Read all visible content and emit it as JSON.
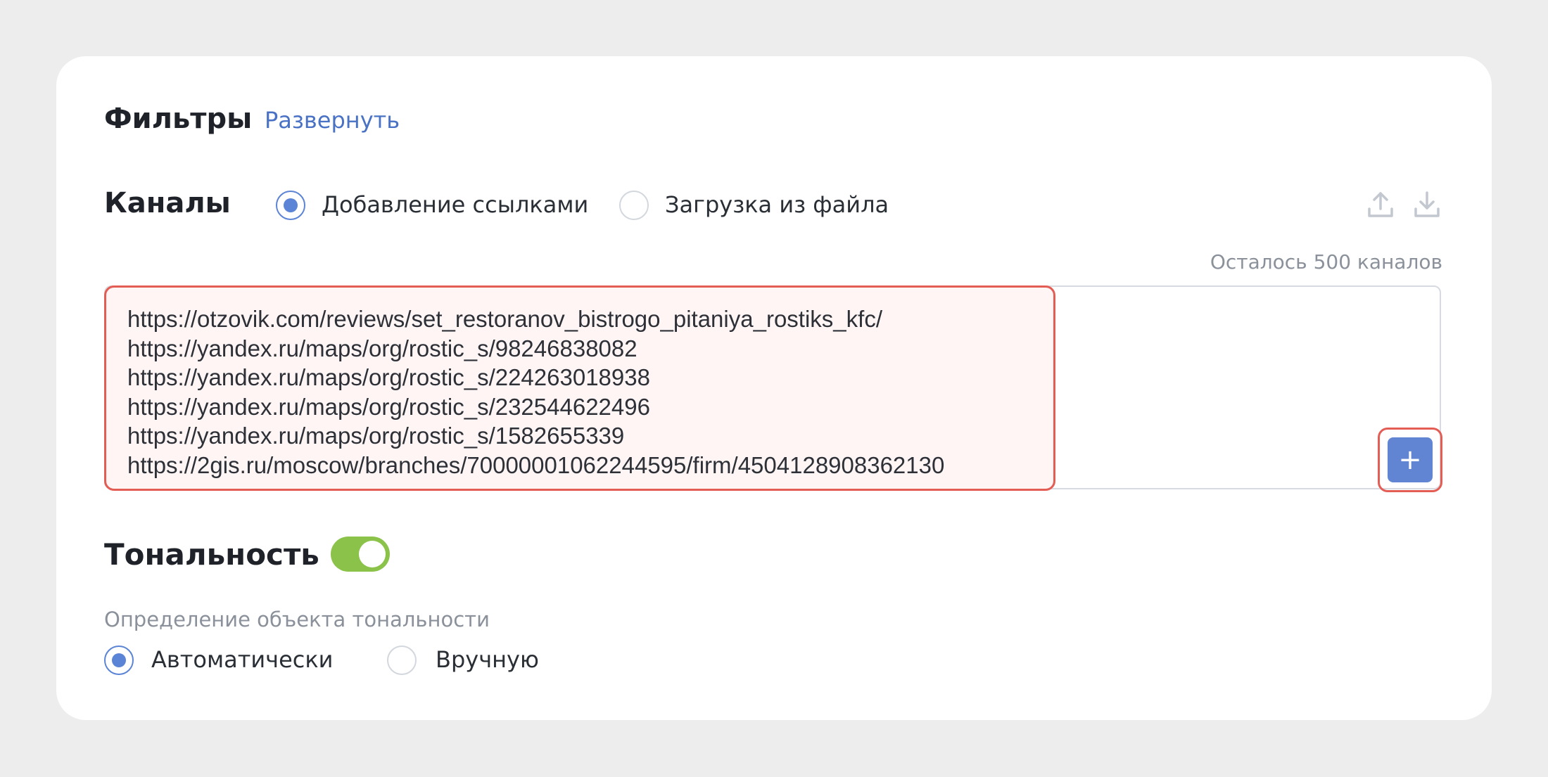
{
  "filters": {
    "title": "Фильтры",
    "expand_label": "Развернуть"
  },
  "channels": {
    "title": "Каналы",
    "mode_links_label": "Добавление ссылками",
    "mode_file_label": "Загрузка из файла",
    "selected_mode": "links",
    "remaining_label": "Осталось 500 каналов",
    "links": [
      "https://otzovik.com/reviews/set_restoranov_bistrogo_pitaniya_rostiks_kfc/",
      "https://yandex.ru/maps/org/rostic_s/98246838082",
      "https://yandex.ru/maps/org/rostic_s/224263018938",
      "https://yandex.ru/maps/org/rostic_s/232544622496",
      "https://yandex.ru/maps/org/rostic_s/1582655339",
      "https://2gis.ru/moscow/branches/70000001062244595/firm/4504128908362130"
    ],
    "add_button_label": "+"
  },
  "tonality": {
    "title": "Тональность",
    "enabled": true,
    "object_label": "Определение объекта тональности",
    "auto_label": "Автоматически",
    "manual_label": "Вручную",
    "selected": "auto"
  },
  "colors": {
    "accent": "#5b84d6",
    "toggle_on": "#8bc34a",
    "highlight_border": "#e35d55",
    "highlight_fill": "#fff5f5",
    "add_button": "#6184d3"
  },
  "icons": {
    "upload": "upload-icon",
    "download": "download-icon"
  }
}
